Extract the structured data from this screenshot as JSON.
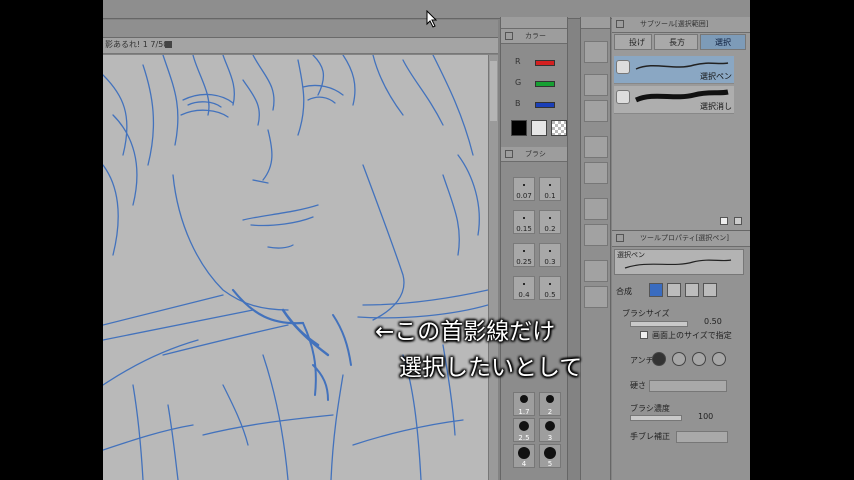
{
  "document": {
    "tab_label": "影あるれ! 1 7/50"
  },
  "color_panel": {
    "header": "カラー",
    "channels": [
      {
        "label": "R",
        "color": "#d42020"
      },
      {
        "label": "G",
        "color": "#16a032"
      },
      {
        "label": "B",
        "color": "#1a3fb8"
      }
    ],
    "main_color": "#ffffff",
    "sub_color": "#000000"
  },
  "brush_size_panel": {
    "header": "ブラシ",
    "sizes": [
      "0.07",
      "0.1",
      "0.15",
      "0.2",
      "0.25",
      "0.3",
      "0.4",
      "0.5"
    ],
    "large_sizes": [
      "1.7",
      "2",
      "2.5",
      "3",
      "4",
      "5"
    ]
  },
  "sub_tool_panel": {
    "header": "サブツール[選択範囲]",
    "tabs": [
      "投げ",
      "長方",
      "選択"
    ],
    "items": [
      "選択ペン",
      "選択消し"
    ]
  },
  "tool_property": {
    "header": "ツールプロパティ[選択ペン]",
    "preview_label": "選択ペン",
    "combine_label": "合成",
    "brush_size_label": "ブラシサイズ",
    "brush_size_value": "0.50",
    "screen_size_label": "画面上のサイズで指定",
    "antialias_label": "アンチ",
    "hardness_label": "硬さ",
    "density_label": "ブラシ濃度",
    "density_value": "100",
    "stabilization_label": "手ブレ補正"
  },
  "caption": {
    "line1": "←この首影線だけ",
    "line2": "選択したいとして"
  },
  "sketch_color": "#3d6fbd"
}
